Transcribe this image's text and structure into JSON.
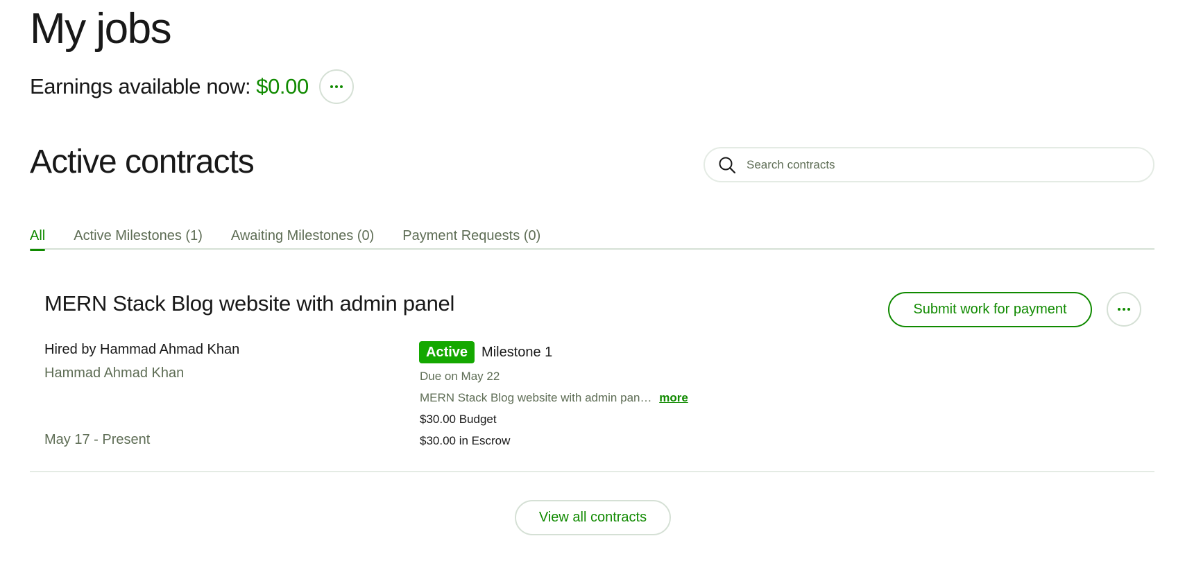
{
  "page": {
    "title": "My jobs"
  },
  "earnings": {
    "label": "Earnings available now:",
    "amount": "$0.00",
    "more_icon": "ellipsis-icon"
  },
  "active_contracts": {
    "title": "Active contracts",
    "search": {
      "placeholder": "Search contracts",
      "value": "",
      "icon": "search-icon"
    },
    "tabs": [
      {
        "label": "All",
        "active": true
      },
      {
        "label": "Active Milestones (1)",
        "active": false
      },
      {
        "label": "Awaiting Milestones (0)",
        "active": false
      },
      {
        "label": "Payment Requests (0)",
        "active": false
      }
    ]
  },
  "contract": {
    "title": "MERN Stack Blog website with admin panel",
    "submit_label": "Submit work for payment",
    "hired_by": "Hired by Hammad Ahmad Khan",
    "client_name": "Hammad Ahmad Khan",
    "date_range": "May 17 - Present",
    "milestone": {
      "status": "Active",
      "name": "Milestone 1",
      "due": "Due on May 22",
      "description": "MERN Stack Blog website with admin pan…",
      "more_label": "more",
      "budget": "$30.00 Budget",
      "escrow": "$30.00 in Escrow"
    }
  },
  "footer": {
    "view_all_label": "View all contracts"
  },
  "colors": {
    "accent": "#108a00",
    "badge": "#14a800",
    "text": "#181818",
    "muted": "#5e6d55",
    "border": "#d5e0d5"
  }
}
